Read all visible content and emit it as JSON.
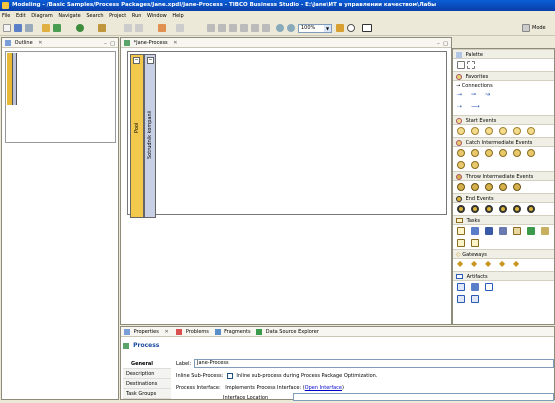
{
  "window": {
    "title": "Modeling - /Basic Samples/Process Packages/Jane.xpdl/Jane-Process - TIBCO Business Studio - E:\\Jane\\ИТ в управлении качеством\\Лабы"
  },
  "menu": [
    "File",
    "Edit",
    "Diagram",
    "Navigate",
    "Search",
    "Project",
    "Run",
    "Window",
    "Help"
  ],
  "toolbar": {
    "zoom_value": "100%",
    "mode_label": "Mode"
  },
  "outline": {
    "tab_label": "Outline"
  },
  "editor": {
    "tab_label": "*Jane-Process",
    "pool_label": "Pool",
    "lane_label": "Sotrudnik kompanii"
  },
  "palette": {
    "header": "Palette",
    "favorites": "Favorites",
    "connections": "Connections",
    "start_events": "Start Events",
    "catch_events": "Catch Intermediate Events",
    "throw_events": "Throw Intermediate Events",
    "end_events": "End Events",
    "tasks": "Tasks",
    "gateways": "Gateways",
    "artifacts": "Artifacts"
  },
  "bottom_tabs": {
    "properties": "Properties",
    "problems": "Problems",
    "fragments": "Fragments",
    "data_source": "Data Source Explorer"
  },
  "properties": {
    "title": "Process",
    "side_tabs": [
      "General",
      "Description",
      "Destinations",
      "Task Groups"
    ],
    "label_caption": "Label:",
    "label_value": "Jane-Process",
    "inline_caption": "Inline Sub-Process:",
    "inline_text": "Inline sub-process during Process Package Optimization.",
    "interface_caption": "Process Interface:",
    "implements_text": "Implements Process Interface:",
    "open_interface": "Open Interface",
    "interface_location": "Interface Location"
  },
  "colors": {
    "title_bar": "#0a4fc4",
    "pool_fill": "#f2c94c",
    "lane_fill": "#c8d0e6",
    "start_event": "#f5dc8a",
    "end_event": "#d9b43a",
    "link": "#0000cc"
  }
}
